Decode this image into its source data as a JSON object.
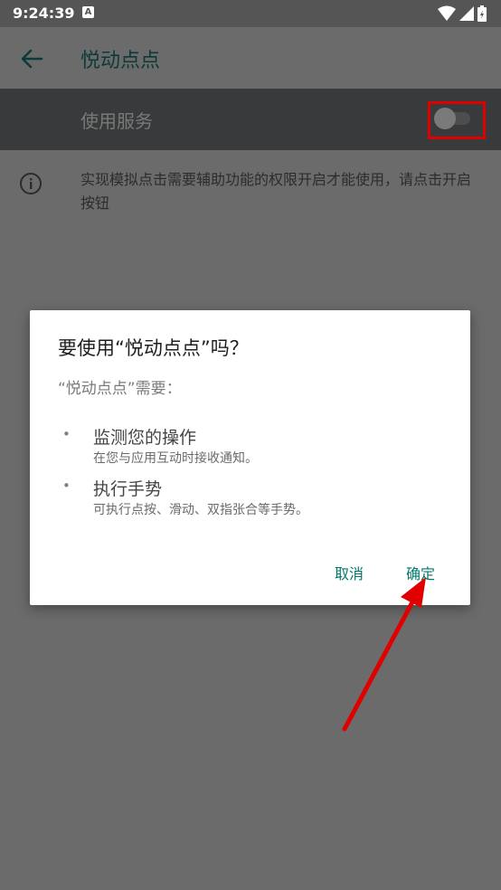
{
  "status_bar": {
    "time": "9:24:39",
    "notification_icon": "A"
  },
  "app_bar": {
    "title": "悦动点点",
    "back_icon": "arrow-left"
  },
  "service": {
    "label": "使用服务",
    "enabled": false
  },
  "info": {
    "text": "实现模拟点击需要辅助功能的权限开启才能使用，请点击开启按钮",
    "icon": "info-circle"
  },
  "dialog": {
    "title": "要使用“悦动点点”吗？",
    "subtitle": "“悦动点点”需要：",
    "capabilities": [
      {
        "bullet": "•",
        "title": "监测您的操作",
        "desc": "在您与应用互动时接收通知。"
      },
      {
        "bullet": "•",
        "title": "执行手势",
        "desc": "可执行点按、滑动、双指张合等手势。"
      }
    ],
    "cancel_label": "取消",
    "ok_label": "确定"
  },
  "colors": {
    "accent": "#00796b",
    "highlight": "#e00000",
    "scrim": "#6b6b6b"
  }
}
